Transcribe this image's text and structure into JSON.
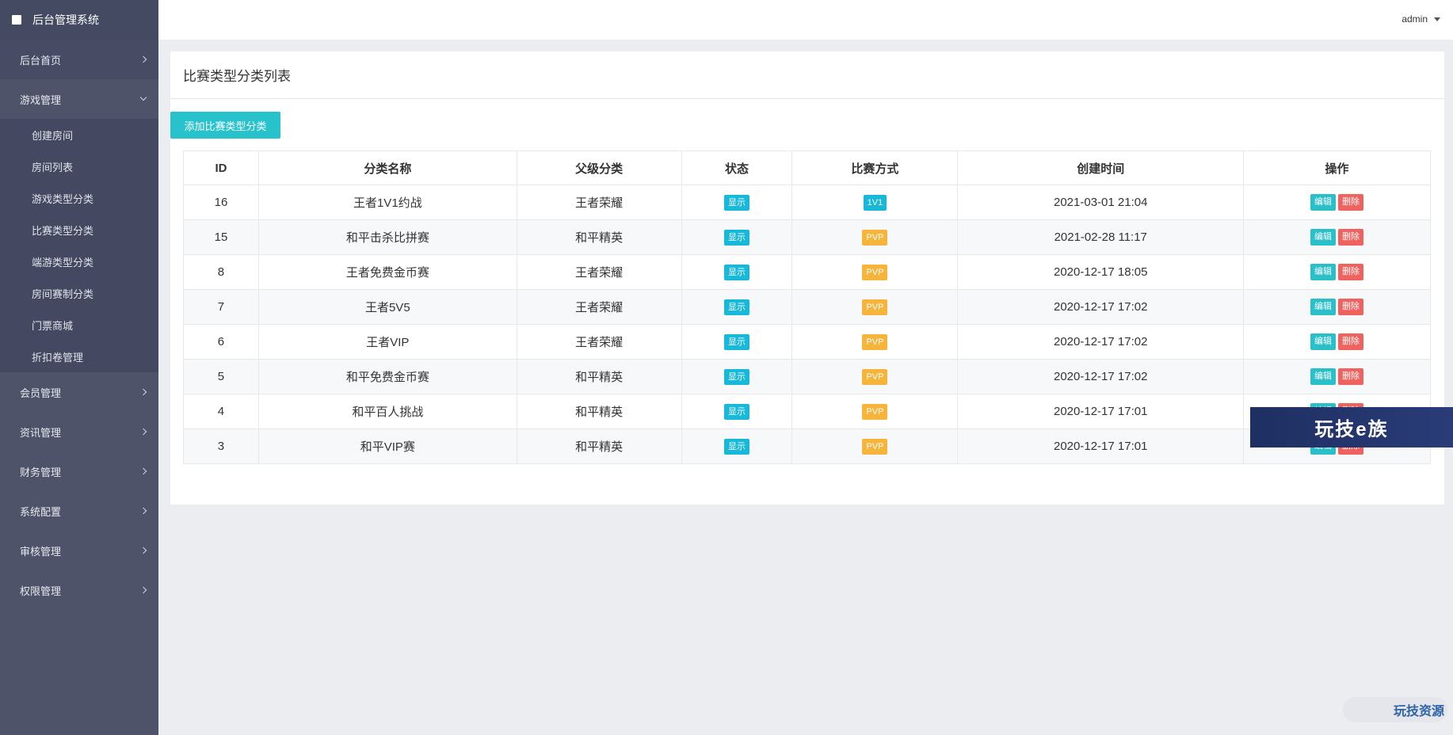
{
  "app": {
    "title": "后台管理系统"
  },
  "header": {
    "user": "admin"
  },
  "sidebar": {
    "home": "后台首页",
    "game_mgmt": "游戏管理",
    "game_sub": [
      "创建房间",
      "房间列表",
      "游戏类型分类",
      "比赛类型分类",
      "端游类型分类",
      "房间赛制分类",
      "门票商城",
      "折扣卷管理"
    ],
    "sections": [
      "会员管理",
      "资讯管理",
      "财务管理",
      "系统配置",
      "审核管理",
      "权限管理"
    ]
  },
  "page": {
    "title": "比赛类型分类列表",
    "add_button": "添加比赛类型分类"
  },
  "table": {
    "headers": [
      "ID",
      "分类名称",
      "父级分类",
      "状态",
      "比赛方式",
      "创建时间",
      "操作"
    ],
    "rows": [
      {
        "id": "16",
        "name": "王者1V1约战",
        "parent": "王者荣耀",
        "status": "显示",
        "mode": "1V1",
        "created": "2021-03-01 21:04"
      },
      {
        "id": "15",
        "name": "和平击杀比拼赛",
        "parent": "和平精英",
        "status": "显示",
        "mode": "PVP",
        "created": "2021-02-28 11:17"
      },
      {
        "id": "8",
        "name": "王者免费金币赛",
        "parent": "王者荣耀",
        "status": "显示",
        "mode": "PVP",
        "created": "2020-12-17 18:05"
      },
      {
        "id": "7",
        "name": "王者5V5",
        "parent": "王者荣耀",
        "status": "显示",
        "mode": "PVP",
        "created": "2020-12-17 17:02"
      },
      {
        "id": "6",
        "name": "王者VIP",
        "parent": "王者荣耀",
        "status": "显示",
        "mode": "PVP",
        "created": "2020-12-17 17:02"
      },
      {
        "id": "5",
        "name": "和平免费金币赛",
        "parent": "和平精英",
        "status": "显示",
        "mode": "PVP",
        "created": "2020-12-17 17:02"
      },
      {
        "id": "4",
        "name": "和平百人挑战",
        "parent": "和平精英",
        "status": "显示",
        "mode": "PVP",
        "created": "2020-12-17 17:01"
      },
      {
        "id": "3",
        "name": "和平VIP赛",
        "parent": "和平精英",
        "status": "显示",
        "mode": "PVP",
        "created": "2020-12-17 17:01"
      }
    ],
    "edit_label": "编辑",
    "delete_label": "删除"
  },
  "watermarks": {
    "banner": "玩技e族",
    "corner": "玩技资源"
  },
  "colors": {
    "sidebar": "#4f5369",
    "accent": "#27c2cc",
    "pvp": "#f6b43a",
    "delete": "#f0625f"
  }
}
